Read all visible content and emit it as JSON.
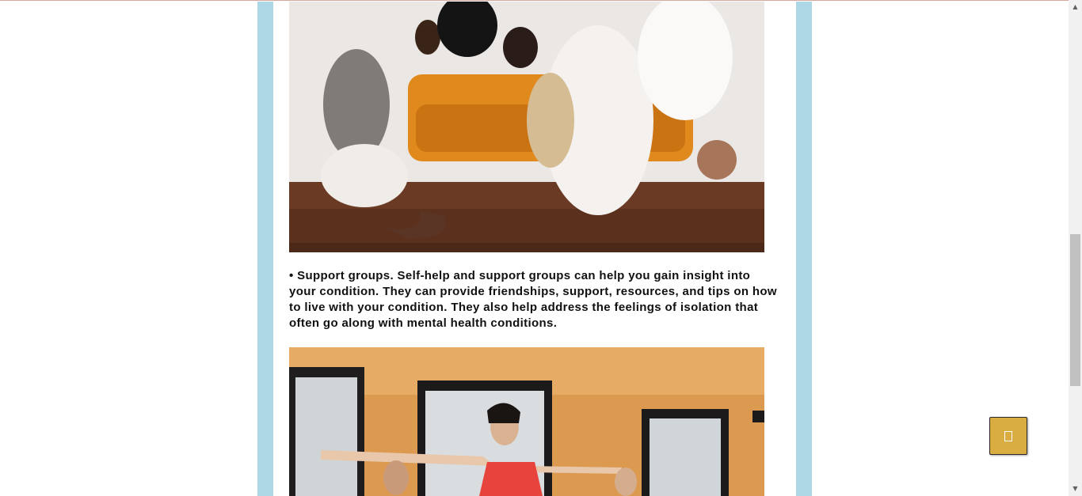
{
  "article": {
    "paragraph": "• Support groups. Self-help and support groups can help you gain insight into your condition. They can provide friendships, support, resources, and tips on how to live with your condition. They also help address the feelings of isolation that often go along with mental health conditions."
  },
  "colors": {
    "side_band": "#aed8e6",
    "back_to_top_button": "#d9ad42",
    "scrollbar_track": "#f1f1f1",
    "scrollbar_thumb": "#c1c1c1"
  },
  "scrollbar": {
    "up_arrow_icon": "triangle-up",
    "down_arrow_icon": "triangle-down"
  },
  "back_to_top": {
    "icon": "missing-glyph-box"
  }
}
